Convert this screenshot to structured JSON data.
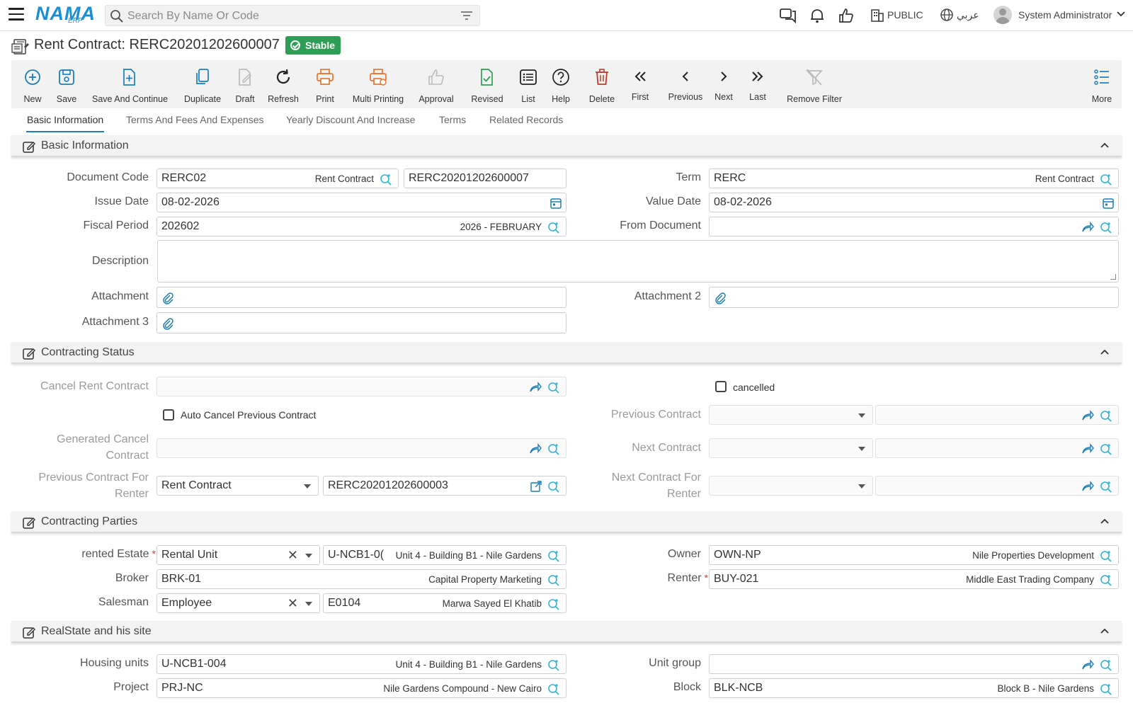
{
  "topbar": {
    "logo": "NAMA",
    "logo_sub": "ERP",
    "search_placeholder": "Search By Name Or Code",
    "public_label": "PUBLIC",
    "language_label": "عربي",
    "user_name": "System Administrator"
  },
  "page": {
    "title": "Rent Contract: RERC20201202600007",
    "status_badge": "Stable"
  },
  "toolbar": {
    "new": "New",
    "save": "Save",
    "save_continue": "Save And Continue",
    "duplicate": "Duplicate",
    "draft": "Draft",
    "refresh": "Refresh",
    "print": "Print",
    "multi_printing": "Multi Printing",
    "approval": "Approval",
    "revised": "Revised",
    "list": "List",
    "help": "Help",
    "delete": "Delete",
    "first": "First",
    "previous": "Previous",
    "next": "Next",
    "last": "Last",
    "remove_filter": "Remove Filter",
    "more": "More"
  },
  "tabs": [
    "Basic Information",
    "Terms And Fees And Expenses",
    "Yearly Discount And Increase",
    "Terms",
    "Related Records"
  ],
  "sections": {
    "basic": "Basic Information",
    "status": "Contracting Status",
    "parties": "Contracting Parties",
    "realestate": "RealState and his site"
  },
  "basic": {
    "doc_code_label": "Document Code",
    "doc_code": "RERC02",
    "doc_code_sub": "Rent Contract",
    "doc_number": "RERC20201202600007",
    "term_label": "Term",
    "term": "RERC",
    "term_sub": "Rent Contract",
    "issue_date_label": "Issue Date",
    "issue_date": "08-02-2026",
    "value_date_label": "Value Date",
    "value_date": "08-02-2026",
    "fiscal_label": "Fiscal Period",
    "fiscal": "202602",
    "fiscal_sub": "2026 - FEBRUARY",
    "from_doc_label": "From Document",
    "description_label": "Description",
    "attachment_label": "Attachment",
    "attachment2_label": "Attachment 2",
    "attachment3_label": "Attachment 3"
  },
  "status": {
    "cancel_rent_label": "Cancel Rent Contract",
    "cancelled_label": "cancelled",
    "auto_cancel_label": "Auto Cancel Previous Contract",
    "prev_contract_label": "Previous Contract",
    "gen_cancel_label_1": "Generated Cancel",
    "gen_cancel_label_2": "Contract",
    "next_contract_label": "Next Contract",
    "prev_renter_label_1": "Previous Contract For",
    "prev_renter_label_2": "Renter",
    "prev_renter_type": "Rent Contract",
    "prev_renter_code": "RERC20201202600003",
    "next_renter_label_1": "Next Contract For",
    "next_renter_label_2": "Renter"
  },
  "parties": {
    "estate_label": "rented Estate",
    "estate_type": "Rental Unit",
    "estate_code": "U-NCB1-0(",
    "estate_sub": "Unit 4 - Building B1 - Nile Gardens",
    "owner_label": "Owner",
    "owner_code": "OWN-NP",
    "owner_sub": "Nile Properties Development",
    "broker_label": "Broker",
    "broker_code": "BRK-01",
    "broker_sub": "Capital Property Marketing",
    "renter_label": "Renter",
    "renter_code": "BUY-021",
    "renter_sub": "Middle East Trading Company",
    "salesman_label": "Salesman",
    "salesman_type": "Employee",
    "salesman_code": "E0104",
    "salesman_sub": "Marwa Sayed El Khatib",
    "required_mark": "*"
  },
  "realestate": {
    "housing_label": "Housing units",
    "housing_code": "U-NCB1-004",
    "housing_sub": "Unit 4 - Building B1 - Nile Gardens",
    "unit_group_label": "Unit group",
    "project_label": "Project",
    "project_code": "PRJ-NC",
    "project_sub": "Nile Gardens Compound - New Cairo",
    "block_label": "Block",
    "block_code": "BLK-NCB",
    "block_sub": "Block B - Nile Gardens"
  },
  "colors": {
    "accent": "#1b7fb9",
    "status_green": "#2e9e55",
    "delete_red": "#c0392b",
    "print_orange": "#e8752d",
    "lookup_cyan": "#30b4d8"
  }
}
